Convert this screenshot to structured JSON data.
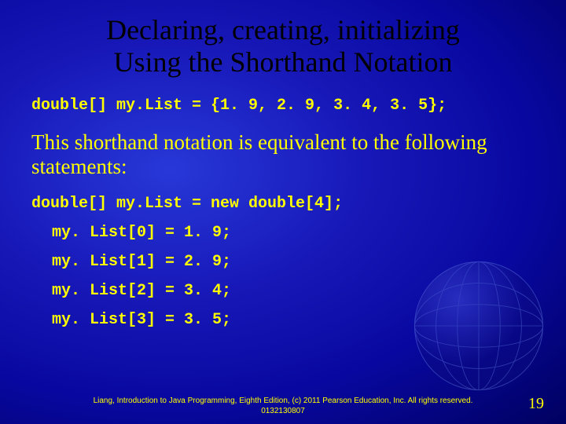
{
  "title_line1": "Declaring, creating, initializing",
  "title_line2": "Using the Shorthand Notation",
  "code_decl": "double[] my.List = {1. 9, 2. 9, 3. 4, 3. 5};",
  "body_text": "This shorthand notation is equivalent to the following statements:",
  "code_lines": [
    "double[] my.List = new double[4];",
    "my. List[0] = 1. 9;",
    "my. List[1] = 2. 9;",
    "my. List[2] = 3. 4;",
    "my. List[3] = 3. 5;"
  ],
  "footer": "Liang, Introduction to Java Programming, Eighth Edition, (c) 2011 Pearson Education, Inc. All rights reserved. 0132130807",
  "page_number": "19"
}
